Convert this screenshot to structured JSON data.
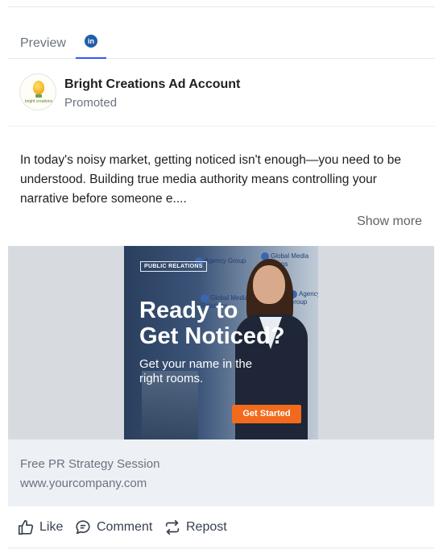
{
  "tabs": {
    "preview_label": "Preview",
    "linkedin_badge": "in"
  },
  "post": {
    "account_name": "Bright Creations Ad Account",
    "promoted_label": "Promoted",
    "avatar_logo_text": "bright creations",
    "body": "In today's noisy market, getting noticed isn't enough—you need to be understood. Building true media authority means controlling your narrative before someone e....",
    "show_more_label": "Show more"
  },
  "ad": {
    "tag": "PUBLIC RELATIONS",
    "headline_line1": "Ready to",
    "headline_line2": "Get Noticed?",
    "sub_line1": "Get your name in the",
    "sub_line2": "right rooms.",
    "cta_label": "Get Started",
    "bg_logo_1": "Agency Group",
    "bg_logo_2": "Global Media Relations",
    "bg_logo_3": "Agency Group",
    "bg_logo_4": "Global Media Relations"
  },
  "link_card": {
    "title": "Free PR Strategy Session",
    "url": "www.yourcompany.com"
  },
  "actions": {
    "like_label": "Like",
    "comment_label": "Comment",
    "repost_label": "Repost"
  },
  "colors": {
    "accent": "#2e5bff",
    "linkedin_blue": "#1f5fa8",
    "cta_orange": "#f26a1b"
  },
  "icons": {
    "like": "thumbs-up-icon",
    "comment": "comment-icon",
    "repost": "repost-icon",
    "linkedin": "linkedin-icon"
  }
}
